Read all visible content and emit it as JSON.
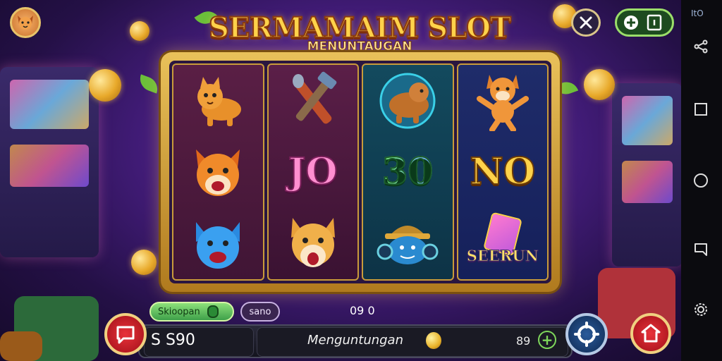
{
  "game": {
    "title": "SERMAMAIM SLOT",
    "subtitle": "MENUNTAUGAN"
  },
  "reels": [
    {
      "symbols": [
        "cat-icon",
        "fox-icon",
        "blue-cat-icon"
      ]
    },
    {
      "symbols": [
        "hammer-icon",
        "JO",
        "shiba-icon"
      ],
      "text_value": "JO"
    },
    {
      "symbols": [
        "otter-icon",
        "30",
        "robot-fish-icon"
      ],
      "text_value": "30"
    },
    {
      "symbols": [
        "dancing-fox-icon",
        "NO",
        "SEERUN"
      ],
      "text_value": "NO",
      "banner": "SEERUN"
    }
  ],
  "pills": {
    "green_label": "Skioopan",
    "dark_label": "sano",
    "center_value": "09 0"
  },
  "bottom_bar": {
    "balance": "S S90",
    "label": "Menguntungan",
    "bet_value": "89",
    "plus": "+"
  },
  "navbar": {
    "top_text": "ItO"
  },
  "colors": {
    "gold": "#ffd24a",
    "frame": "#e9c15a",
    "accent_red": "#e8323a",
    "accent_green": "#7dd65a"
  }
}
